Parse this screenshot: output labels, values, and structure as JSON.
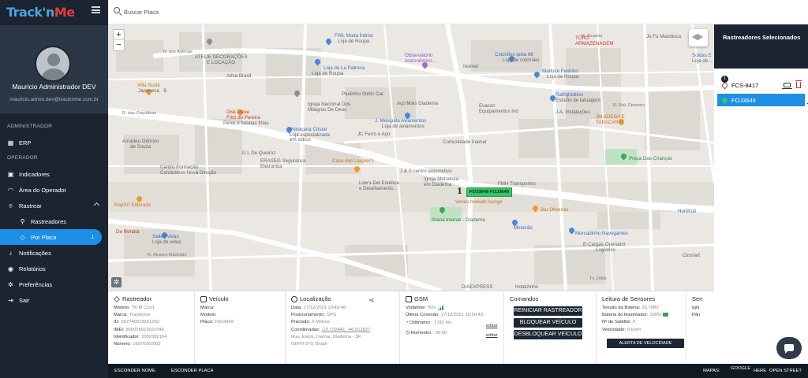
{
  "app": {
    "logo_main": "Track'n",
    "logo_accent": "Me"
  },
  "user": {
    "name": "Mauricio Administrador DEV",
    "email": "mauricio.admin.dev@trackinme.com.br"
  },
  "sidebar": {
    "section_admin": "ADMINISTRADOR",
    "section_operator": "OPERADOR",
    "items": [
      {
        "label": "ERP"
      },
      {
        "label": "Indicadores"
      },
      {
        "label": "Área do Operador"
      },
      {
        "label": "Rastrear"
      },
      {
        "label": "Rastreadores"
      },
      {
        "label": "Por Placa",
        "badge": "1"
      },
      {
        "label": "Notificações"
      },
      {
        "label": "Relatórios"
      },
      {
        "label": "Preferências"
      },
      {
        "label": "Sair"
      }
    ]
  },
  "search": {
    "placeholder": "Buscar Placa"
  },
  "map": {
    "zoom_in": "+",
    "zoom_out": "−",
    "labels": {
      "atelie": "ATELIE DECORAÇÕES",
      "atelie2": "E LOCAÇÃO",
      "adsa": "Adsa Brasil",
      "fwl": "FWL Moda Íntima",
      "fwl2": "Loja de Roupa",
      "lapatrona": "Loja de La Patrona",
      "lapatrona2": "Loja de Roupa",
      "observatorio": "Observatório",
      "observatorio2": "Astronômico...",
      "colchoes": "Colchões ipitia 66",
      "colchoes2": "Loja de colchões",
      "toro": "TORO",
      "toro2": "ARMAZENAGEM",
      "jufu": "Ju Fu Mandioca",
      "soldas": "Soldas E",
      "soldas2": "Loja de ...",
      "inamar": "Inamar",
      "marluce": "Marluce Fashion",
      "marluce2": "Loja de Roupa",
      "villa": "Villa Sushi",
      "villa2": "Japonesa · $",
      "paulinho": "Paulinho Stetic Car",
      "igreja": "Igreja Nacional Dos",
      "igreja2": "Milagres De Deus",
      "aco": "Aço Mais Diadema",
      "evacon": "Evacon",
      "evacon2": "Equipamentos Ind",
      "raffi": "Raffightattoo",
      "raffi2": "Estúdio de tatuagem",
      "ja": "J.A. Instalações",
      "disk": "Disk Peixe",
      "disk2": "Frito do Pereira",
      "disk3": "Peixe e batatas fritas",
      "vidr": "Vidraçaria Cristal",
      "vidr2": "Loja especializada",
      "vidr3": "em vidros",
      "jmesq": "J. Mesquita Aviamentos",
      "jmesq2": "Loja de aviamentos",
      "jmadega": "JM ADEGA E",
      "jmadega2": "TABACARIA",
      "jcferro": "JC Ferro e Aço",
      "comunidade": "Comunidade Inamar",
      "amadeu": "Amadeu Odorico",
      "amadeu2": "de Souza",
      "dlq": "D L De Queiroz",
      "eraseg": "ERASEG Segurança",
      "eraseg2": "Eletronica",
      "laigner": "Casa dos Laigner's",
      "centro": "Centro Formação",
      "centro2": "Condutores Nova Direção",
      "praca": "Praça Das Crianças",
      "js": "J & S centro automotivo",
      "lows": "Low's Det Estética",
      "lows2": "e Detalhamento...",
      "metodista": "Igreja Metodista",
      "metodista2": "em Diadema",
      "fmh": "FMH Transportes",
      "hookah": "Venus hookah lounge",
      "rapi": "Rapi10 Eldorado",
      "arena": "Arena Inamar - Diadema",
      "bar": "Bar Oliveiras",
      "hortifruti": "Hortifruti",
      "renata": "De Renata",
      "mineirao": "Mineirão",
      "mercadinho": "Mercadinho Navegantes",
      "sallev": "Sallev Velas",
      "sallev2": "Loja de velas",
      "ecargas": "E-Cargas Operador",
      "ecargas2": "Logístico",
      "diaexpress": "DIAEXPRESS",
      "hotel": "Hotelzinho",
      "ozonart": "Ozonart",
      "s_asteca": "R. dos Astecas",
      "s_orquideas": "R. das Orquídeas",
      "s_alcateia": "R. Alcateia",
      "s_sarga": "R. Sarga",
      "s_alv": "R. Álvares Machado",
      "s_mao": "R. Mal. Deodoro",
      "s_tv": "Tv. Odila"
    },
    "vehicle_marker": "FOJ3649 FOJ3649",
    "cluster_number": "1"
  },
  "right_panel": {
    "title": "Rastreadores Selecionados",
    "count": "1",
    "items": [
      {
        "label": "FCS-8417",
        "active": false
      },
      {
        "label": "FOJ3649",
        "active": true
      }
    ]
  },
  "info": {
    "rastreador": {
      "title": "Rastreador",
      "rows": [
        {
          "k": "Modelo:",
          "v": "TK M C101"
        },
        {
          "k": "Marca:",
          "v": "Trackinme"
        },
        {
          "k": "ID:",
          "v": "597740918361292"
        },
        {
          "k": "IMEI:",
          "v": "860016023021046"
        },
        {
          "k": "Identificador:",
          "v": "1002302104"
        },
        {
          "k": "Número:",
          "v": "16976062802"
        }
      ]
    },
    "veiculo": {
      "title": "Veículo",
      "rows": [
        {
          "k": "Marca:",
          "v": ""
        },
        {
          "k": "Modelo:",
          "v": ""
        },
        {
          "k": "Placa:",
          "v": "FOJ3649"
        }
      ]
    },
    "localizacao": {
      "title": "Localização",
      "rows": [
        {
          "k": "Data:",
          "v": "17/12/2021 10:49:48"
        },
        {
          "k": "Posicionamento:",
          "v": "GPS"
        },
        {
          "k": "Precisão:",
          "v": "0 Metros"
        },
        {
          "k": "Coordenadas:",
          "v": "-23.722442, -46.612827"
        }
      ],
      "address1": "Rua Joacis, Inamar, Diadema - SP,",
      "address2": "09970-370, Brasil"
    },
    "gsm": {
      "title": "GSM",
      "operator_k": "Vodafone",
      "operator_v": "75%",
      "last_k": "Última Conexão:",
      "last_v": "17/12/2021 10:50:43",
      "odometer_k": "Odômetro :",
      "odometer_v": "1781 km",
      "hourmeter_k": "Horímetro :",
      "hourmeter_v": "00:00",
      "editor": "editar"
    },
    "comandos": {
      "title": "Comandos",
      "buttons": [
        "REINICIAR RASTREADOR",
        "BLOQUEAR VEÍCULO",
        "DESBLOQUEAR VEÍCULO"
      ]
    },
    "sensores": {
      "title": "Leitura de Sensores",
      "rows": [
        {
          "k": "Tensão da Bateria:",
          "v": "25.798V"
        },
        {
          "k": "Bateria do Rastreador:",
          "v": "100%"
        },
        {
          "k": "Nº de Satélite:",
          "v": "0"
        },
        {
          "k": "Velocidade:",
          "v": "0 km/h"
        }
      ],
      "speed_alert": "ALERTA DE VELOCIDADE"
    },
    "extra": {
      "title": "Sen",
      "rows": [
        "Igni",
        "Pân"
      ]
    }
  },
  "footer": {
    "hide_name": "ESCONDER NOME",
    "hide_plate": "ESCONDER PLACA",
    "maps": "MAPAS:",
    "google": "GOOGLE",
    "here": "HERE",
    "osm": "OPEN STREET"
  },
  "colors": {
    "sidebar": "#1b2430",
    "accent": "#1e8fe6",
    "vehicle": "#37c46a",
    "danger": "#d0342c"
  }
}
